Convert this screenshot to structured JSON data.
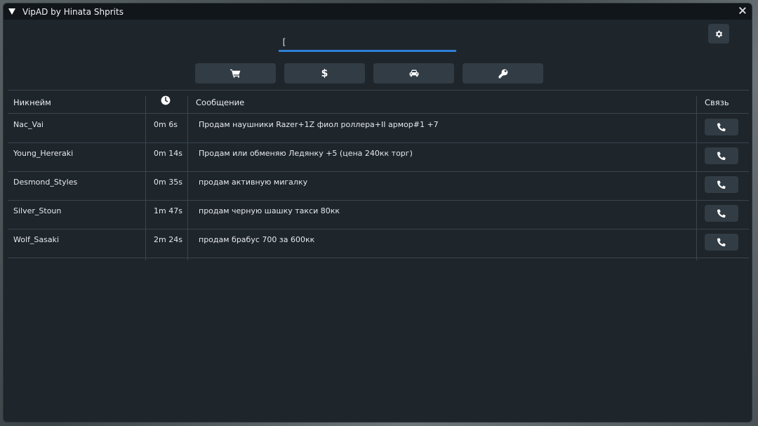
{
  "window": {
    "title": "VipAD by Hinata Shprits"
  },
  "search": {
    "value": "["
  },
  "categories": [
    {
      "name": "shop",
      "icon": "cart-icon"
    },
    {
      "name": "money",
      "icon": "dollar-icon",
      "symbol": "$"
    },
    {
      "name": "vehicles",
      "icon": "car-icon"
    },
    {
      "name": "property",
      "icon": "key-icon"
    }
  ],
  "table": {
    "headers": {
      "nick": "Никнейм",
      "time_icon": "clock-icon",
      "message": "Сообщение",
      "contact": "Связь"
    },
    "rows": [
      {
        "nick": "Nac_Vai",
        "time": "0m 6s",
        "message": "Продам наушники Razer+1Z фиол роллера+II армор#1 +7"
      },
      {
        "nick": "Young_Hereraki",
        "time": "0m 14s",
        "message": "Продам или обменяю Ледянку +5 (цена 240кк торг)"
      },
      {
        "nick": "Desmond_Styles",
        "time": "0m 35s",
        "message": "продам активную мигалку"
      },
      {
        "nick": "Silver_Stoun",
        "time": "1m 47s",
        "message": "продам черную шашку такси 80кк"
      },
      {
        "nick": "Wolf_Sasaki",
        "time": "2m 24s",
        "message": "продам брабус 700 за 600кк"
      }
    ]
  },
  "colors": {
    "accent": "#2d7fd6",
    "panel": "#1e252b",
    "button": "#323c44"
  }
}
